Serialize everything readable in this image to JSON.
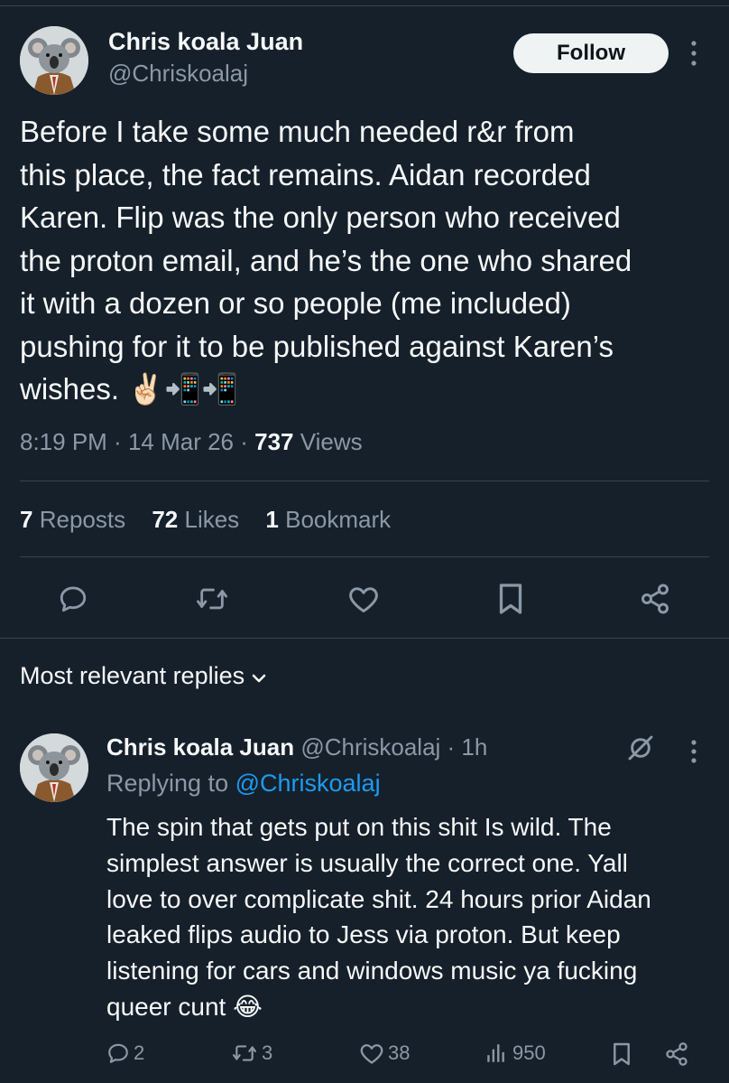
{
  "tweet": {
    "author": {
      "name": "Chris koala Juan",
      "handle": "@Chriskoalaj"
    },
    "follow_label": "Follow",
    "text_lines": [
      "Before I take some much needed r&r from",
      "this place, the fact remains. Aidan recorded",
      "Karen. Flip was the only person who received",
      "the proton email, and he’s the one who shared",
      "it with a dozen or so people (me included)",
      "pushing for it to be published against Karen’s",
      "wishes. ✌🏻📲📲"
    ],
    "time": "8:19 PM",
    "date": "14 Mar 26",
    "views": "737",
    "views_label": "Views",
    "stats": {
      "reposts": "7",
      "reposts_label": "Reposts",
      "likes": "72",
      "likes_label": "Likes",
      "bookmarks": "1",
      "bookmarks_label": "Bookmark"
    }
  },
  "actions": [
    "reply-icon",
    "repost-icon",
    "like-icon",
    "bookmark-icon",
    "share-icon"
  ],
  "replies_section": {
    "title": "Most relevant replies"
  },
  "reply": {
    "author": {
      "name": "Chris koala Juan",
      "handle": "@Chriskoalaj"
    },
    "time": "1h",
    "replying_prefix": "Replying to",
    "replying_to": "@Chriskoalaj",
    "text_lines": [
      "The spin that gets put on this shit Is wild. The",
      "simplest answer is usually the correct one. Yall",
      "love to over complicate shit. 24 hours prior Aidan",
      "leaked flips audio to Jess via proton. But keep",
      "listening for cars and windows music ya fucking",
      "queer cunt 😂"
    ],
    "counts": {
      "replies": "2",
      "reposts": "3",
      "likes": "38",
      "views": "950"
    }
  },
  "colors": {
    "background": "#15202b",
    "text": "#f7f9f9",
    "muted": "#8b98a5",
    "link": "#1d9bf0",
    "divider": "#38444d"
  }
}
